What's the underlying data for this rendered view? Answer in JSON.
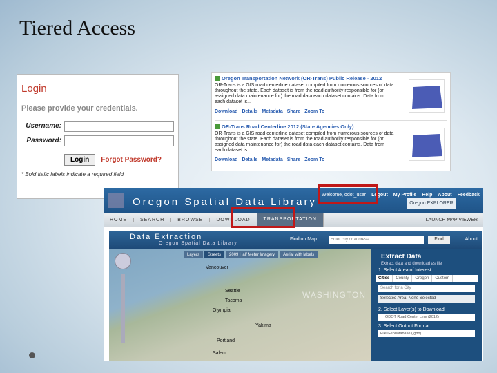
{
  "slide": {
    "title": "Tiered Access"
  },
  "login": {
    "heading": "Login",
    "prompt": "Please provide your credentials.",
    "username_label": "Username:",
    "password_label": "Password:",
    "login_button": "Login",
    "forgot_link": "Forgot Password?",
    "required_note": "* Bold Italic labels indicate a required field"
  },
  "datasets": [
    {
      "title": "Oregon Transportation Network (OR-Trans) Public Release - 2012",
      "description": "OR-Trans is a GIS road centerline dataset compiled from numerous sources of data throughout the state. Each dataset is from the road authority responsible for (or assigned data maintenance for) the road data each dataset contains. Data from each dataset is...",
      "links": [
        "Download",
        "Details",
        "Metadata",
        "Share",
        "Zoom To"
      ]
    },
    {
      "title": "OR-Trans Road Centerline 2012 (State Agencies Only)",
      "description": "OR-Trans is a GIS road centerline dataset compiled from numerous sources of data throughout the state. Each dataset is from the road authority responsible for (or assigned data maintenance for) the road data each dataset contains. Data from each dataset is...",
      "links": [
        "Download",
        "Details",
        "Metadata",
        "Share",
        "Zoom To"
      ]
    }
  ],
  "osdl": {
    "title": "Oregon Spatial Data Library",
    "welcome": "Welcome, odot_user",
    "header_links": [
      "Logout",
      "My Profile",
      "Help",
      "About",
      "Feedback"
    ],
    "explorer_badge": "Oregon EXPLORER",
    "nav": [
      "HOME",
      "SEARCH",
      "BROWSE",
      "DOWNLOAD",
      "TRANSPORTATION"
    ],
    "launch_link": "LAUNCH MAP VIEWER",
    "extraction": {
      "title": "Data Extraction",
      "subtitle": "Oregon Spatial Data Library",
      "find_label": "Find on Map",
      "find_placeholder": "Enter city or address",
      "find_button": "Find",
      "about": "About"
    },
    "map": {
      "tabs": [
        "Layers",
        "Streets",
        "2009 Half Meter Imagery",
        "Aerial with labels"
      ],
      "labels": [
        "Vancouver",
        "Seattle",
        "Tacoma",
        "Olympia",
        "Yakima",
        "Portland",
        "Salem"
      ],
      "state_label": "WASHINGTON"
    },
    "extract_panel": {
      "title": "Extract Data",
      "subtitle": "Extract data and download as file",
      "step1": "1. Select Area of Interest",
      "area_tabs": [
        "Cities",
        "County",
        "Oregon",
        "Custom"
      ],
      "city_placeholder": "Search for a City",
      "selected_area": "Selected Area: None Selected",
      "step2": "2. Select Layer(s) to Download",
      "layer": "ODOT Road Center Line (2012)",
      "step3": "3. Select Output Format",
      "format": "File Geodatabase (.gdb)"
    }
  }
}
